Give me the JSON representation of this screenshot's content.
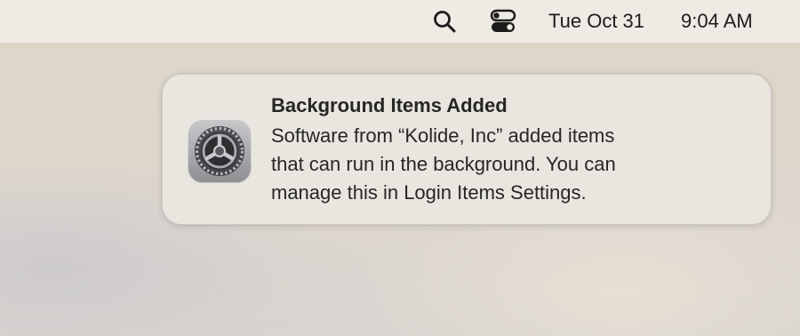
{
  "menubar": {
    "search_icon": "search-icon",
    "control_center_icon": "control-center-icon",
    "date": "Tue Oct 31",
    "time": "9:04 AM"
  },
  "notification": {
    "app_icon": "system-settings-gear-icon",
    "title": "Background Items Added",
    "body_lines": [
      "Software from “Kolide, Inc” added items",
      "that can run in the background. You can",
      "manage this in Login Items Settings."
    ]
  }
}
